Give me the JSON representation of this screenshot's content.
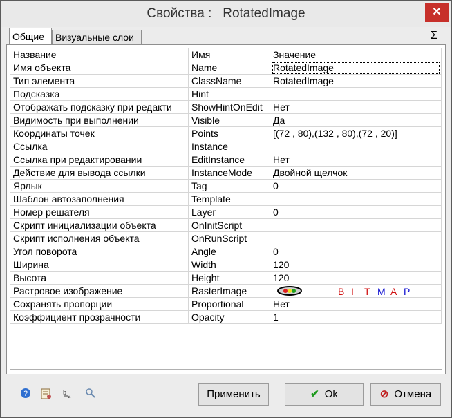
{
  "window": {
    "title": "Свойства :   RotatedImage",
    "close_glyph": "✕"
  },
  "tabs": [
    {
      "label": "Общие",
      "active": true
    },
    {
      "label": "Визуальные слои",
      "active": false
    }
  ],
  "sigma_glyph": "Σ",
  "table": {
    "headers": [
      "Название",
      "Имя",
      "Значение"
    ],
    "rows": [
      {
        "title": "Имя объекта",
        "name": "Name",
        "value": "RotatedImage"
      },
      {
        "title": "Тип элемента",
        "name": "ClassName",
        "value": "RotatedImage"
      },
      {
        "title": "Подсказка",
        "name": "Hint",
        "value": ""
      },
      {
        "title": "Отображать подсказку при редакти",
        "name": "ShowHintOnEdit",
        "value": "Нет"
      },
      {
        "title": "Видимость при выполнении",
        "name": "Visible",
        "value": "Да"
      },
      {
        "title": "Координаты точек",
        "name": "Points",
        "value": "[(72 , 80),(132 , 80),(72 , 20)]"
      },
      {
        "title": "Ссылка",
        "name": "Instance",
        "value": ""
      },
      {
        "title": "Ссылка при редактировании",
        "name": "EditInstance",
        "value": "Нет"
      },
      {
        "title": "Действие для вывода ссылки",
        "name": "InstanceMode",
        "value": "Двойной щелчок"
      },
      {
        "title": "Ярлык",
        "name": "Tag",
        "value": "0"
      },
      {
        "title": "Шаблон автозаполнения",
        "name": "Template",
        "value": ""
      },
      {
        "title": "Номер решателя",
        "name": "Layer",
        "value": "0"
      },
      {
        "title": "Скрипт инициализации объекта",
        "name": "OnInitScript",
        "value": ""
      },
      {
        "title": "Скрипт исполнения объекта",
        "name": "OnRunScript",
        "value": ""
      },
      {
        "title": "Угол поворота",
        "name": "Angle",
        "value": "0"
      },
      {
        "title": "Ширина",
        "name": "Width",
        "value": "120"
      },
      {
        "title": "Высота",
        "name": "Height",
        "value": "120"
      },
      {
        "title": "Растровое изображение",
        "name": "RasterImage",
        "value": ""
      },
      {
        "title": "Сохранять пропорции",
        "name": "Proportional",
        "value": "Нет"
      },
      {
        "title": "Коэффициент прозрачности",
        "name": "Opacity",
        "value": "1"
      }
    ]
  },
  "bitmap_letters": [
    {
      "ch": "B",
      "color": "#d01010"
    },
    {
      "ch": "I",
      "color": "#d01010"
    },
    {
      "ch": "T",
      "color": "#d01010"
    },
    {
      "ch": "M",
      "color": "#1010d0"
    },
    {
      "ch": "A",
      "color": "#d01010"
    },
    {
      "ch": "P",
      "color": "#1010d0"
    }
  ],
  "footer": {
    "icons": [
      "help-icon",
      "properties-icon",
      "text-case-icon",
      "search-icon"
    ],
    "apply_label": "Применить",
    "ok_label": "Ok",
    "cancel_label": "Отмена"
  },
  "colors": {
    "close": "#c7302a",
    "ok_check": "#1e9a1e",
    "cancel_icon": "#c02020"
  }
}
